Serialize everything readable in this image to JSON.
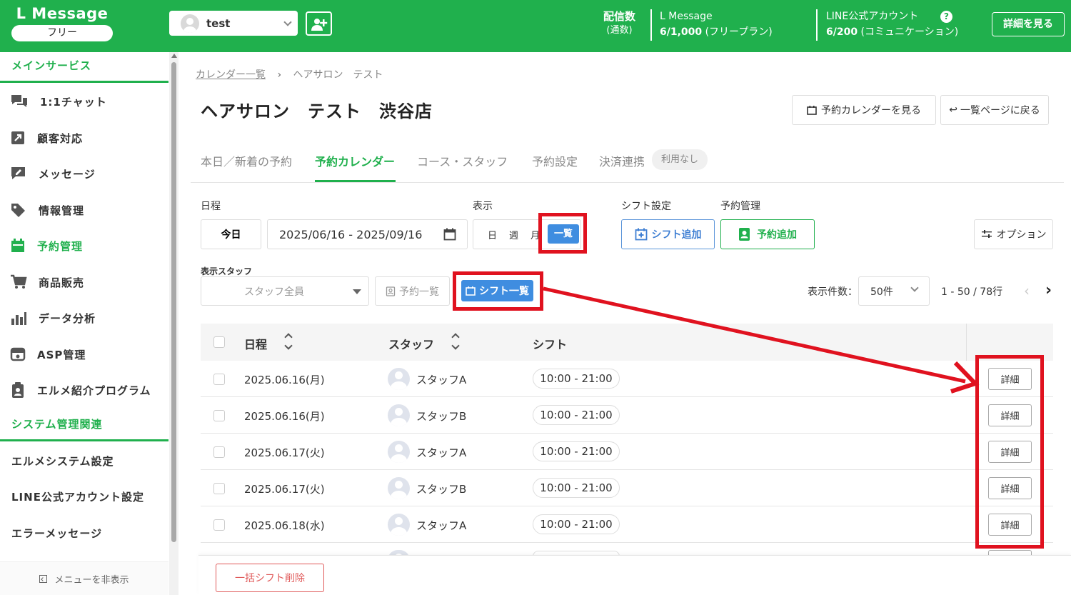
{
  "header": {
    "brand": "L Message",
    "plan": "フリー",
    "account_name": "test",
    "delivery_label": "配信数",
    "delivery_sub": "(通数)",
    "lmessage_label": "L Message",
    "lmessage_count": "6/1,000",
    "lmessage_plan": "(フリープラン)",
    "line_label": "LINE公式アカウント",
    "line_count": "6/200",
    "line_plan": "(コミュニケーション)",
    "help": "?",
    "detail_button": "詳細を見る"
  },
  "sidebar": {
    "section_main": "メインサービス",
    "items": [
      {
        "label": "1:1チャット"
      },
      {
        "label": "顧客対応"
      },
      {
        "label": "メッセージ"
      },
      {
        "label": "情報管理"
      },
      {
        "label": "予約管理"
      },
      {
        "label": "商品販売"
      },
      {
        "label": "データ分析"
      },
      {
        "label": "ASP管理"
      },
      {
        "label": "エルメ紹介プログラム"
      }
    ],
    "section_system": "システム管理関連",
    "system_items": [
      {
        "label": "エルメシステム設定"
      },
      {
        "label": "LINE公式アカウント設定"
      },
      {
        "label": "エラーメッセージ"
      }
    ],
    "footer": "メニューを非表示"
  },
  "breadcrumb": {
    "parent": "カレンダー一覧",
    "current": "ヘアサロン　テスト"
  },
  "page": {
    "title": "ヘアサロン　テスト　渋谷店",
    "view_calendar": "予約カレンダーを見る",
    "back_to_list": "一覧ページに戻る"
  },
  "tabs": [
    {
      "label": "本日／新着の予約"
    },
    {
      "label": "予約カレンダー"
    },
    {
      "label": "コース・スタッフ"
    },
    {
      "label": "予約設定"
    },
    {
      "label": "決済連携"
    }
  ],
  "tab_badge": "利用なし",
  "filters": {
    "schedule_label": "日程",
    "today": "今日",
    "date_range": "2025/06/16 - 2025/09/16",
    "display_label": "表示",
    "views": [
      "日",
      "週",
      "月",
      "一覧"
    ],
    "shift_settings_label": "シフト設定",
    "add_shift": "シフト追加",
    "resv_mgmt_label": "予約管理",
    "add_reservation": "予約追加",
    "options": "オプション",
    "staff_label": "表示スタッフ",
    "staff_placeholder": "スタッフ全員",
    "reservation_list": "予約一覧",
    "shift_list": "シフト一覧",
    "per_page_label": "表示件数：",
    "per_page_value": "50件",
    "range": "1 - 50 / 78行"
  },
  "table": {
    "headers": {
      "date": "日程",
      "staff": "スタッフ",
      "shift": "シフト"
    },
    "detail_label": "詳細",
    "rows": [
      {
        "date": "2025.06.16(月)",
        "staff": "スタッフA",
        "shift": "10:00 - 21:00"
      },
      {
        "date": "2025.06.16(月)",
        "staff": "スタッフB",
        "shift": "10:00 - 21:00"
      },
      {
        "date": "2025.06.17(火)",
        "staff": "スタッフA",
        "shift": "10:00 - 21:00"
      },
      {
        "date": "2025.06.17(火)",
        "staff": "スタッフB",
        "shift": "10:00 - 21:00"
      },
      {
        "date": "2025.06.18(水)",
        "staff": "スタッフA",
        "shift": "10:00 - 21:00"
      }
    ]
  },
  "bottom": {
    "bulk_delete": "一括シフト削除"
  },
  "colors": {
    "brand_green": "#20b04d",
    "active_blue": "#3f8de0",
    "annotation_red": "#e0121f"
  }
}
